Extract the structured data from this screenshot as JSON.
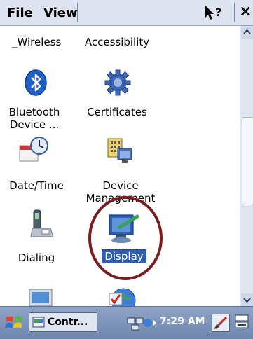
{
  "menubar": {
    "file": "File",
    "view": "View",
    "help_icon": "help-question-arrow-icon",
    "close_glyph": "×"
  },
  "items": [
    {
      "label": "_Wireless",
      "icon": "none"
    },
    {
      "label": "Accessibility",
      "icon": "none"
    },
    {
      "label_line1": "Bluetooth",
      "label_line2": "Device ...",
      "icon": "bluetooth-icon"
    },
    {
      "label": "Certificates",
      "icon": "gear-icon"
    },
    {
      "label": "Date/Time",
      "icon": "clock-calendar-icon"
    },
    {
      "label_line1": "Device",
      "label_line2": "Management",
      "icon": "device-management-icon"
    },
    {
      "label": "Dialing",
      "icon": "phone-icon"
    },
    {
      "label": "Display",
      "icon": "display-icon",
      "selected": true
    }
  ],
  "taskbar": {
    "start_icon": "windows-flag-icon",
    "task_label": "Contr...",
    "time": "7:29 AM",
    "tray_icons": [
      "network-icon",
      "stylus-icon",
      "keyboard-icon"
    ]
  },
  "colors": {
    "menubar_bg": "#dde4ef",
    "selection": "#2f5fb3",
    "annotation_circle": "#7a1f1f"
  }
}
